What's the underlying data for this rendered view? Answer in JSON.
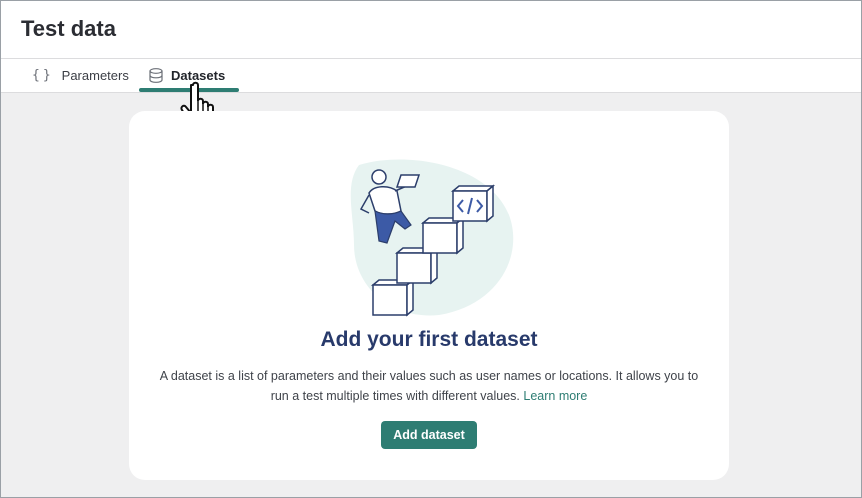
{
  "header": {
    "title": "Test data"
  },
  "tabs": [
    {
      "label": "Parameters",
      "icon": "curly-braces-icon",
      "active": false
    },
    {
      "label": "Datasets",
      "icon": "database-icon",
      "active": true
    }
  ],
  "empty_state": {
    "title": "Add your first dataset",
    "description": "A dataset is a list of parameters and their values such as user names or locations. It allows you to run a test multiple times with different values.",
    "learn_more": "Learn more",
    "button_label": "Add dataset",
    "illustration_icon": "person-climbing-stairs-code-icon"
  },
  "colors": {
    "accent": "#2e7d73",
    "title": "#283a6b",
    "background": "#efeff0",
    "card": "#ffffff"
  }
}
